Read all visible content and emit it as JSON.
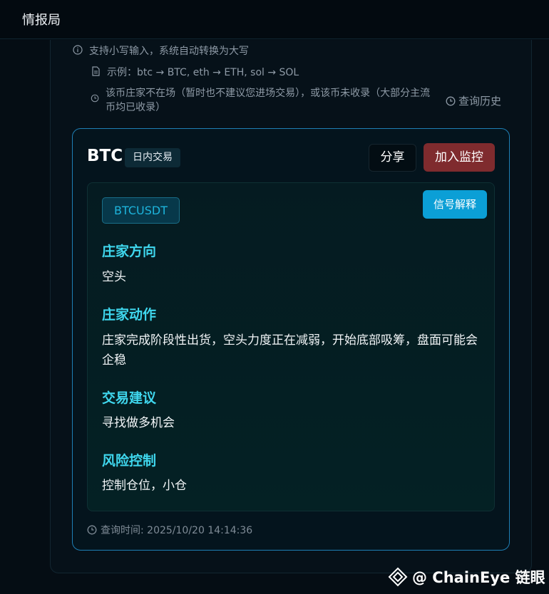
{
  "header": {
    "title": "情报局"
  },
  "hints": {
    "auto_upper": "支持小写输入，系统自动转换为大写",
    "example": "示例：btc → BTC, eth → ETH, sol → SOL",
    "not_present": "该币庄家不在场（暂时也不建议您进场交易），或该币未收录（大部分主流币均已收录）",
    "history_label": "查询历史"
  },
  "card": {
    "coin": "BTC",
    "mode_badge": "日内交易",
    "share_label": "分享",
    "monitor_label": "加入监控",
    "symbol": "BTCUSDT",
    "signal_label": "信号解释",
    "sections": [
      {
        "title": "庄家方向",
        "body": "空头"
      },
      {
        "title": "庄家动作",
        "body": "庄家完成阶段性出货，空头力度正在减弱，开始底部吸筹，盘面可能会企稳"
      },
      {
        "title": "交易建议",
        "body": "寻找做多机会"
      },
      {
        "title": "风险控制",
        "body": "控制仓位，小仓"
      }
    ],
    "query_time": "查询时间: 2025/10/20 14:14:36"
  },
  "watermark": {
    "text": "@ ChainEye 链眼"
  },
  "colors": {
    "accent": "#3fd7ee",
    "monitor": "#7f2b2e",
    "signal": "#0b9fd6",
    "card_border": "#1e7fb5"
  },
  "icons": {
    "info": "info-circle-icon",
    "doc": "document-icon",
    "clock": "clock-icon",
    "logo": "chaineye-logo-icon"
  }
}
